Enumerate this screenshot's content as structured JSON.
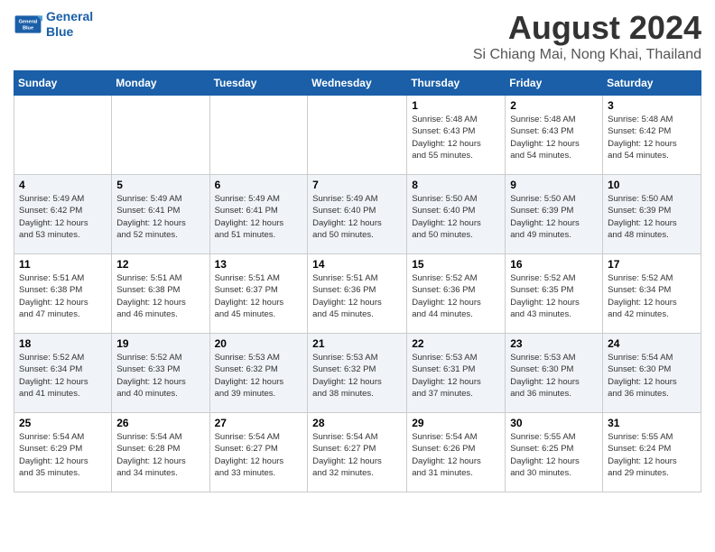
{
  "header": {
    "logo_line1": "General",
    "logo_line2": "Blue",
    "title": "August 2024",
    "subtitle": "Si Chiang Mai, Nong Khai, Thailand"
  },
  "weekdays": [
    "Sunday",
    "Monday",
    "Tuesday",
    "Wednesday",
    "Thursday",
    "Friday",
    "Saturday"
  ],
  "weeks": [
    [
      {
        "day": "",
        "info": ""
      },
      {
        "day": "",
        "info": ""
      },
      {
        "day": "",
        "info": ""
      },
      {
        "day": "",
        "info": ""
      },
      {
        "day": "1",
        "info": "Sunrise: 5:48 AM\nSunset: 6:43 PM\nDaylight: 12 hours\nand 55 minutes."
      },
      {
        "day": "2",
        "info": "Sunrise: 5:48 AM\nSunset: 6:43 PM\nDaylight: 12 hours\nand 54 minutes."
      },
      {
        "day": "3",
        "info": "Sunrise: 5:48 AM\nSunset: 6:42 PM\nDaylight: 12 hours\nand 54 minutes."
      }
    ],
    [
      {
        "day": "4",
        "info": "Sunrise: 5:49 AM\nSunset: 6:42 PM\nDaylight: 12 hours\nand 53 minutes."
      },
      {
        "day": "5",
        "info": "Sunrise: 5:49 AM\nSunset: 6:41 PM\nDaylight: 12 hours\nand 52 minutes."
      },
      {
        "day": "6",
        "info": "Sunrise: 5:49 AM\nSunset: 6:41 PM\nDaylight: 12 hours\nand 51 minutes."
      },
      {
        "day": "7",
        "info": "Sunrise: 5:49 AM\nSunset: 6:40 PM\nDaylight: 12 hours\nand 50 minutes."
      },
      {
        "day": "8",
        "info": "Sunrise: 5:50 AM\nSunset: 6:40 PM\nDaylight: 12 hours\nand 50 minutes."
      },
      {
        "day": "9",
        "info": "Sunrise: 5:50 AM\nSunset: 6:39 PM\nDaylight: 12 hours\nand 49 minutes."
      },
      {
        "day": "10",
        "info": "Sunrise: 5:50 AM\nSunset: 6:39 PM\nDaylight: 12 hours\nand 48 minutes."
      }
    ],
    [
      {
        "day": "11",
        "info": "Sunrise: 5:51 AM\nSunset: 6:38 PM\nDaylight: 12 hours\nand 47 minutes."
      },
      {
        "day": "12",
        "info": "Sunrise: 5:51 AM\nSunset: 6:38 PM\nDaylight: 12 hours\nand 46 minutes."
      },
      {
        "day": "13",
        "info": "Sunrise: 5:51 AM\nSunset: 6:37 PM\nDaylight: 12 hours\nand 45 minutes."
      },
      {
        "day": "14",
        "info": "Sunrise: 5:51 AM\nSunset: 6:36 PM\nDaylight: 12 hours\nand 45 minutes."
      },
      {
        "day": "15",
        "info": "Sunrise: 5:52 AM\nSunset: 6:36 PM\nDaylight: 12 hours\nand 44 minutes."
      },
      {
        "day": "16",
        "info": "Sunrise: 5:52 AM\nSunset: 6:35 PM\nDaylight: 12 hours\nand 43 minutes."
      },
      {
        "day": "17",
        "info": "Sunrise: 5:52 AM\nSunset: 6:34 PM\nDaylight: 12 hours\nand 42 minutes."
      }
    ],
    [
      {
        "day": "18",
        "info": "Sunrise: 5:52 AM\nSunset: 6:34 PM\nDaylight: 12 hours\nand 41 minutes."
      },
      {
        "day": "19",
        "info": "Sunrise: 5:52 AM\nSunset: 6:33 PM\nDaylight: 12 hours\nand 40 minutes."
      },
      {
        "day": "20",
        "info": "Sunrise: 5:53 AM\nSunset: 6:32 PM\nDaylight: 12 hours\nand 39 minutes."
      },
      {
        "day": "21",
        "info": "Sunrise: 5:53 AM\nSunset: 6:32 PM\nDaylight: 12 hours\nand 38 minutes."
      },
      {
        "day": "22",
        "info": "Sunrise: 5:53 AM\nSunset: 6:31 PM\nDaylight: 12 hours\nand 37 minutes."
      },
      {
        "day": "23",
        "info": "Sunrise: 5:53 AM\nSunset: 6:30 PM\nDaylight: 12 hours\nand 36 minutes."
      },
      {
        "day": "24",
        "info": "Sunrise: 5:54 AM\nSunset: 6:30 PM\nDaylight: 12 hours\nand 36 minutes."
      }
    ],
    [
      {
        "day": "25",
        "info": "Sunrise: 5:54 AM\nSunset: 6:29 PM\nDaylight: 12 hours\nand 35 minutes."
      },
      {
        "day": "26",
        "info": "Sunrise: 5:54 AM\nSunset: 6:28 PM\nDaylight: 12 hours\nand 34 minutes."
      },
      {
        "day": "27",
        "info": "Sunrise: 5:54 AM\nSunset: 6:27 PM\nDaylight: 12 hours\nand 33 minutes."
      },
      {
        "day": "28",
        "info": "Sunrise: 5:54 AM\nSunset: 6:27 PM\nDaylight: 12 hours\nand 32 minutes."
      },
      {
        "day": "29",
        "info": "Sunrise: 5:54 AM\nSunset: 6:26 PM\nDaylight: 12 hours\nand 31 minutes."
      },
      {
        "day": "30",
        "info": "Sunrise: 5:55 AM\nSunset: 6:25 PM\nDaylight: 12 hours\nand 30 minutes."
      },
      {
        "day": "31",
        "info": "Sunrise: 5:55 AM\nSunset: 6:24 PM\nDaylight: 12 hours\nand 29 minutes."
      }
    ]
  ]
}
